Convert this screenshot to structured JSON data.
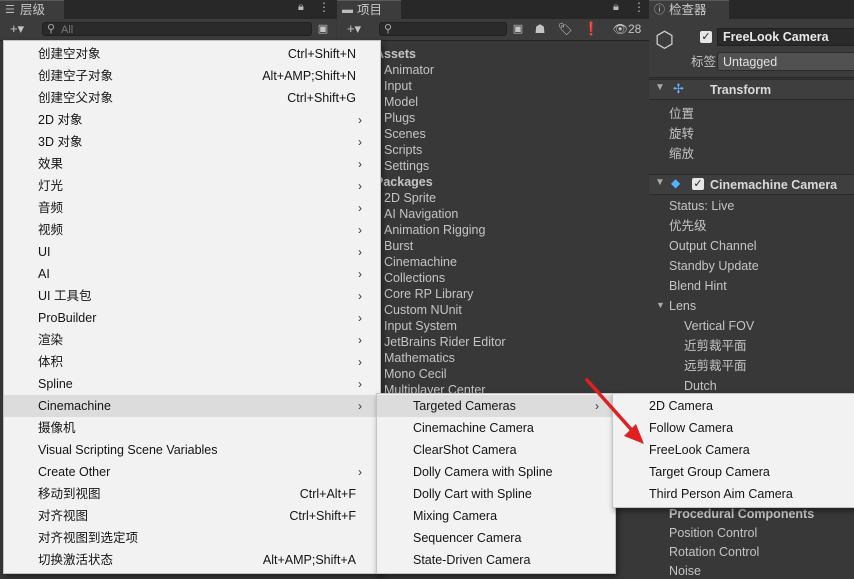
{
  "hierarchy": {
    "tab_label": "层级",
    "search_placeholder": "All",
    "add_button": "+▾"
  },
  "project": {
    "tab_label": "项目",
    "add_button": "+▾",
    "hidden_count": "28",
    "items": [
      {
        "label": "Assets",
        "head": true
      },
      {
        "label": "Animator"
      },
      {
        "label": "Input"
      },
      {
        "label": "Model"
      },
      {
        "label": "Plugs"
      },
      {
        "label": "Scenes"
      },
      {
        "label": "Scripts"
      },
      {
        "label": "Settings"
      },
      {
        "label": "Packages",
        "head": true
      },
      {
        "label": "2D Sprite"
      },
      {
        "label": "AI Navigation"
      },
      {
        "label": "Animation Rigging"
      },
      {
        "label": "Burst"
      },
      {
        "label": "Cinemachine"
      },
      {
        "label": "Collections"
      },
      {
        "label": "Core RP Library"
      },
      {
        "label": "Custom NUnit"
      },
      {
        "label": "Input System"
      },
      {
        "label": "JetBrains Rider Editor"
      },
      {
        "label": "Mathematics"
      },
      {
        "label": "Mono Cecil"
      },
      {
        "label": "Multiplayer Center"
      }
    ]
  },
  "inspector": {
    "tab_label": "检查器",
    "object_name": "FreeLook Camera",
    "tag_label": "标签",
    "tag_value": "Untagged",
    "transform": {
      "title": "Transform",
      "rows": [
        "位置",
        "旋转",
        "缩放"
      ]
    },
    "cinemachine_camera": {
      "title": "Cinemachine Camera",
      "rows": [
        {
          "label": "Status: Live",
          "indent": 0
        },
        {
          "label": "优先级",
          "indent": 0
        },
        {
          "label": "Output Channel",
          "indent": 0
        },
        {
          "label": "Standby Update",
          "indent": 0
        },
        {
          "label": "Blend Hint",
          "indent": 0
        },
        {
          "label": "Lens",
          "indent": 0,
          "foldout": true
        },
        {
          "label": "Vertical FOV",
          "indent": 1
        },
        {
          "label": "近剪裁平面",
          "indent": 1
        },
        {
          "label": "远剪裁平面",
          "indent": 1
        },
        {
          "label": "Dutch",
          "indent": 1
        }
      ]
    },
    "bottom_rows": [
      "Procedural Components",
      "Position Control",
      "Rotation Control",
      "Noise"
    ]
  },
  "main_menu": {
    "items": [
      {
        "label": "创建空对象",
        "shortcut": "Ctrl+Shift+N"
      },
      {
        "label": "创建空子对象",
        "shortcut": "Alt+AMP;Shift+N"
      },
      {
        "label": "创建空父对象",
        "shortcut": "Ctrl+Shift+G"
      },
      {
        "label": "2D 对象",
        "submenu": true
      },
      {
        "label": "3D 对象",
        "submenu": true
      },
      {
        "label": "效果",
        "submenu": true
      },
      {
        "label": "灯光",
        "submenu": true
      },
      {
        "label": "音频",
        "submenu": true
      },
      {
        "label": "视频",
        "submenu": true
      },
      {
        "label": "UI",
        "submenu": true
      },
      {
        "label": "AI",
        "submenu": true
      },
      {
        "label": "UI 工具包",
        "submenu": true
      },
      {
        "label": "ProBuilder",
        "submenu": true
      },
      {
        "label": "渲染",
        "submenu": true
      },
      {
        "label": "体积",
        "submenu": true
      },
      {
        "label": "Spline",
        "submenu": true
      },
      {
        "label": "Cinemachine",
        "submenu": true,
        "highlighted": true
      },
      {
        "label": "摄像机"
      },
      {
        "label": "Visual Scripting Scene Variables"
      },
      {
        "label": "Create Other",
        "submenu": true
      },
      {
        "label": "移动到视图",
        "shortcut": "Ctrl+Alt+F"
      },
      {
        "label": "对齐视图",
        "shortcut": "Ctrl+Shift+F"
      },
      {
        "label": "对齐视图到选定项"
      },
      {
        "label": "切换激活状态",
        "shortcut": "Alt+AMP;Shift+A"
      }
    ]
  },
  "cinemachine_menu": {
    "items": [
      {
        "label": "Targeted Cameras",
        "submenu": true,
        "highlighted": true
      },
      {
        "label": "Cinemachine Camera"
      },
      {
        "label": "ClearShot Camera"
      },
      {
        "label": "Dolly Camera with Spline"
      },
      {
        "label": "Dolly Cart with Spline"
      },
      {
        "label": "Mixing Camera"
      },
      {
        "label": "Sequencer Camera"
      },
      {
        "label": "State-Driven Camera"
      }
    ]
  },
  "targeted_menu": {
    "items": [
      {
        "label": "2D Camera"
      },
      {
        "label": "Follow Camera"
      },
      {
        "label": "FreeLook Camera"
      },
      {
        "label": "Target Group Camera"
      },
      {
        "label": "Third Person Aim Camera"
      }
    ]
  },
  "colors": {
    "menu_bg": "#f2f2f2",
    "menu_highlight": "#dcdcdc",
    "annotation_arrow": "#e02020",
    "editor_bg": "#383838"
  }
}
